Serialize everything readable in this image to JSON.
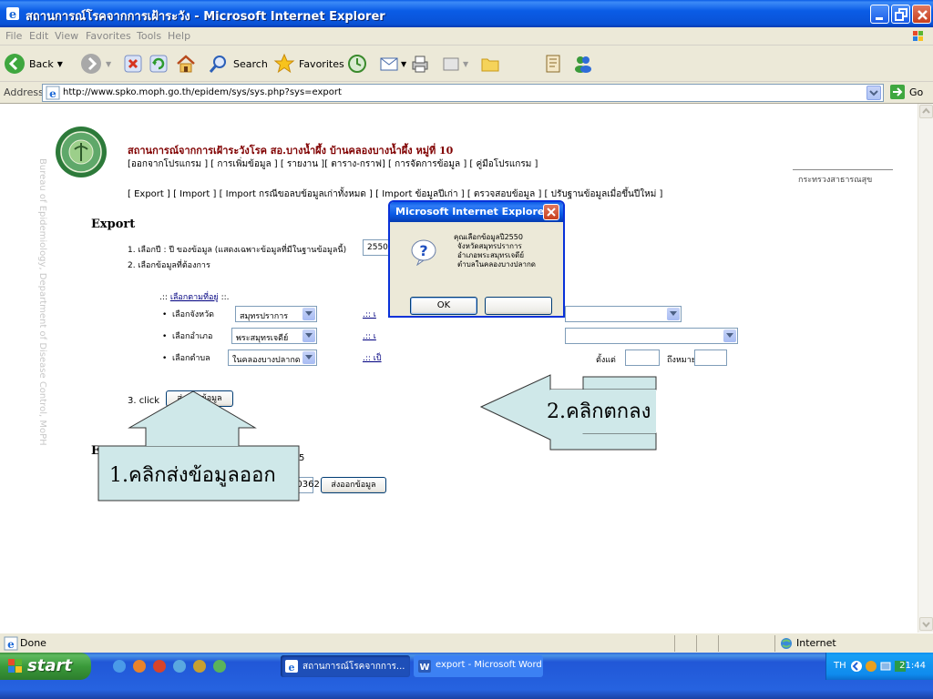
{
  "window": {
    "title": "สถานการณ์โรคจากการเฝ้าระวัง - Microsoft Internet Explorer"
  },
  "menu": [
    "File",
    "Edit",
    "View",
    "Favorites",
    "Tools",
    "Help"
  ],
  "toolbar": {
    "back_label": "Back",
    "search_label": "Search",
    "favorites_label": "Favorites"
  },
  "address": {
    "label": "Address",
    "url": "http://www.spko.moph.go.th/epidem/sys/sys.php?sys=export",
    "go_label": "Go"
  },
  "page": {
    "vertical_text": "Bureau of Epidemiology, Department of Disease Control, MoPH",
    "header_title": "สถานการณ์จากการเฝ้าระวังโรค สอ.บางน้ำผึ้ง บ้านคลองบางน้ำผึ้ง หมู่ที่ 10",
    "header_menu": "[ออกจากโปรแกรม ] [ การเพิ่มข้อมูล ] [ รายงาน ][ ตาราง-กราฟ] [ การจัดการข้อมูล ] [ คู่มือโปรแกรม ]",
    "ministry": "กระทรวงสาธารณสุข",
    "nav2": "[ Export ] [ Import ] [ Import กรณีขอลบข้อมูลเก่าทั้งหมด ] [ Import ข้อมูลปีเก่า ] [ ตรวจสอบข้อมูล ] [ ปรับฐานข้อมูลเมื่อขึ้นปีใหม่ ]",
    "section_export": "Export",
    "step1": "1. เลือกปี : ปี ของข้อมูล (แสดงเฉพาะข้อมูลที่มีในฐานข้อมูลนี้)",
    "year_value": "2550",
    "step2": "2. เลือกข้อมูลที่ต้องการ",
    "by_area_link": "เลือกตามที่อยู่",
    "by_area_prefix": ".::",
    "by_area_suffix": "::.",
    "province_label": "เลือกจังหวัด",
    "province_value": "สมุทรปราการ",
    "district_label": "เลือกอำเภอ",
    "district_value": "พระสมุทรเจดีย์",
    "subdistrict_label": "เลือกตำบล",
    "subdistrict_value": "ในคลองบางปลากด",
    "right_link1": ".:: เ",
    "right_link2": ".:: เ",
    "right_link3": ".:: เป็",
    "from_label": "ตั้งแต่",
    "to_label": "ถึงหมายเลข",
    "step3_prefix": "3. click",
    "submit_label": "ส่งออกข้อมูล",
    "section2_letter": "E",
    "partial_value": "30362",
    "submit2_label": "ส่งออกข้อมูล",
    "partial_digit": "5"
  },
  "dialog": {
    "title": "Microsoft Internet Explorer",
    "message": [
      "คุณเลือกข้อมูลปี2550",
      "จังหวัดสมุทรปราการ",
      "อำเภอพระสมุทรเจดีย์",
      "ตำบลในคลองบางปลากด"
    ],
    "ok_label": "OK"
  },
  "annotations": {
    "callout1": "1.คลิกส่งข้อมูลออก",
    "callout2": "2.คลิกตกลง"
  },
  "status": {
    "text": "Done",
    "zone": "Internet"
  },
  "taskbar": {
    "start_label": "start",
    "task1": "สถานการณ์โรคจากการ...",
    "task2": "export - Microsoft Word",
    "lang": "TH",
    "clock": "21:44"
  },
  "colors": {
    "xp_blue": "#0a5ce6",
    "header_maroon": "#800000",
    "callout_fill": "#cfe8e9"
  }
}
